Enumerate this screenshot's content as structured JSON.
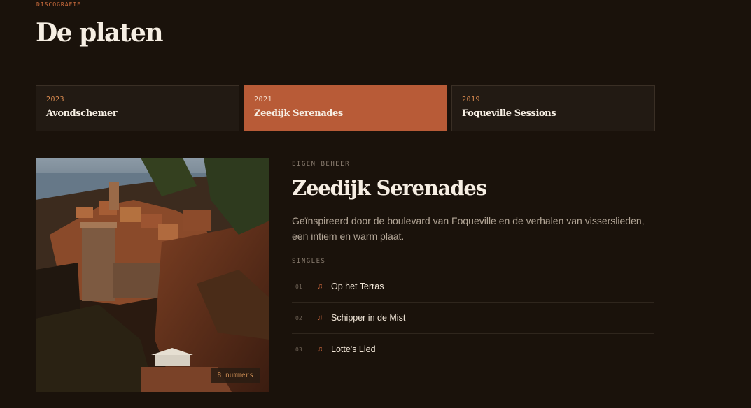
{
  "header": {
    "eyebrow": "DISCOGRAFIE",
    "title": "De platen"
  },
  "tabs": [
    {
      "year": "2023",
      "name": "Avondschemer",
      "active": false
    },
    {
      "year": "2021",
      "name": "Zeedijk Serenades",
      "active": true
    },
    {
      "year": "2019",
      "name": "Foqueville Sessions",
      "active": false
    }
  ],
  "album": {
    "label": "EIGEN BEHEER",
    "title": "Zeedijk Serenades",
    "description": "Geïnspireerd door de boulevard van Foqueville en de verhalen van visserslieden, een intiem en warm plaat.",
    "track_count": "8 nummers",
    "singles_label": "SINGLES",
    "singles": [
      {
        "num": "01",
        "title": "Op het Terras",
        "icon": "music-note-icon"
      },
      {
        "num": "02",
        "title": "Schipper in de Mist",
        "icon": "music-note-icon"
      },
      {
        "num": "03",
        "title": "Lotte's Lied",
        "icon": "music-note-icon"
      }
    ]
  },
  "colors": {
    "background": "#1a120b",
    "accent": "#b85b37",
    "tab_background": "#221a13"
  }
}
